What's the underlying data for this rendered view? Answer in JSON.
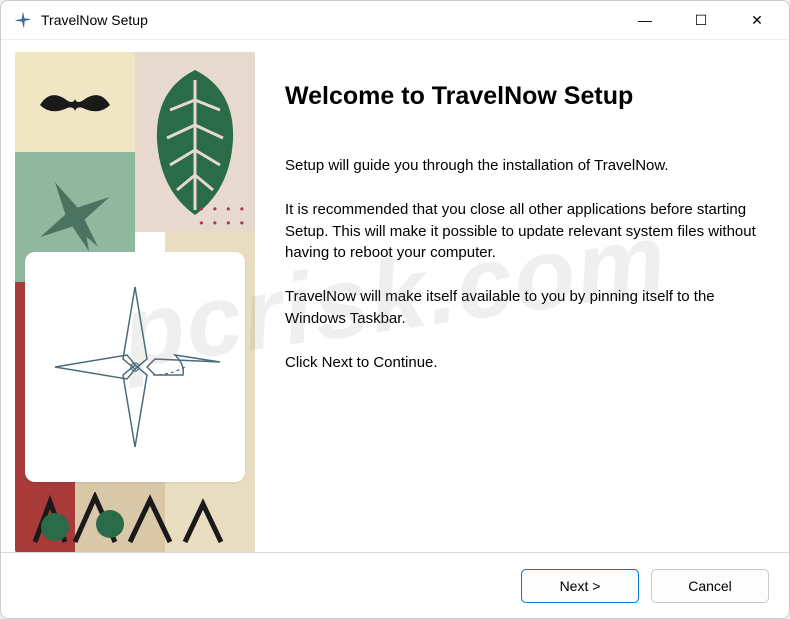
{
  "window": {
    "title": "TravelNow Setup"
  },
  "titlebar": {
    "minimize_glyph": "—",
    "maximize_glyph": "☐",
    "close_glyph": "✕"
  },
  "main": {
    "heading": "Welcome to TravelNow Setup",
    "para1": "Setup will guide you through the installation of TravelNow.",
    "para2": "It is recommended that you close all other applications before starting Setup.  This will make it possible to update relevant system files without having to reboot your computer.",
    "para3": "TravelNow will make itself available to you by pinning itself to the Windows Taskbar.",
    "para4": "Click Next to Continue."
  },
  "footer": {
    "next_label": "Next >",
    "cancel_label": "Cancel"
  },
  "watermark": "pcrisk.com"
}
